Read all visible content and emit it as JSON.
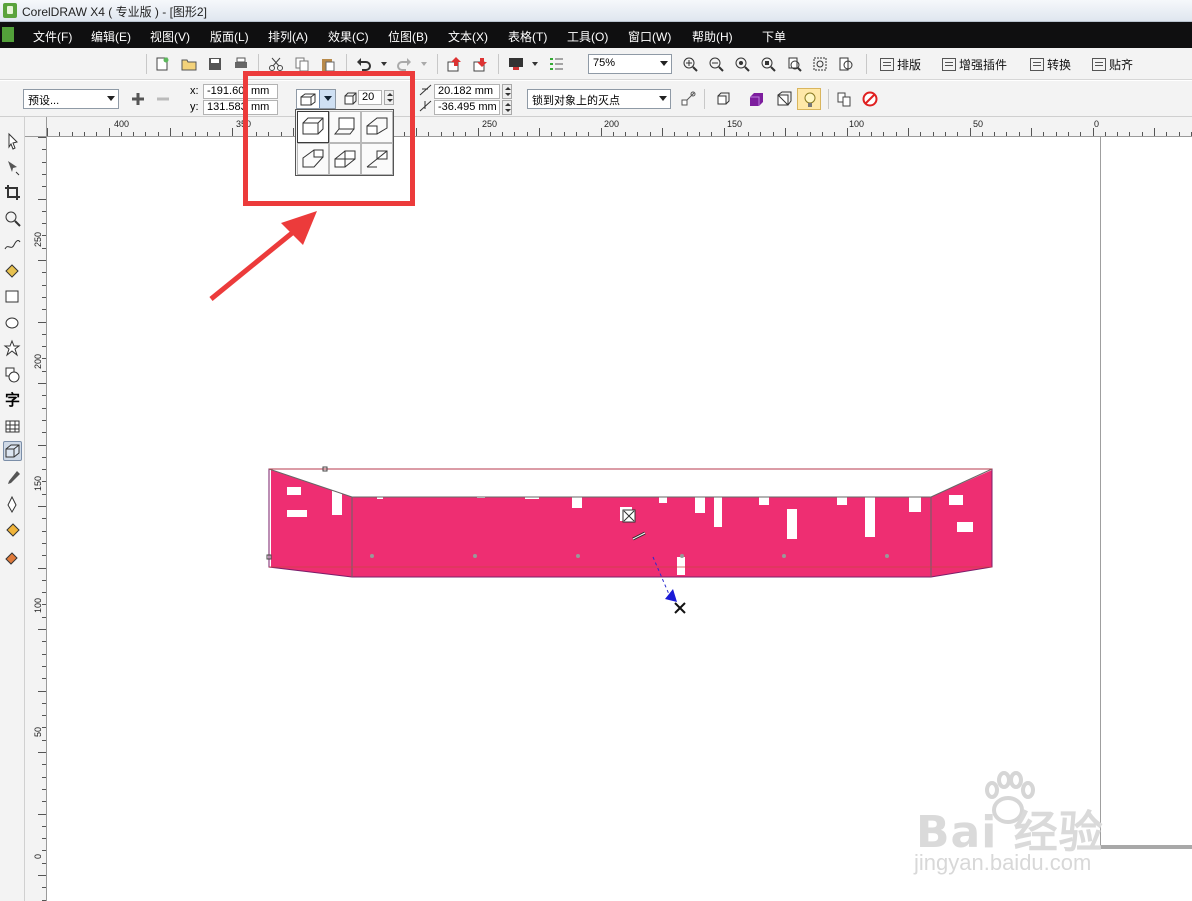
{
  "titlebar": {
    "title": "CorelDRAW X4 ( 专业版 ) - [图形2]"
  },
  "menu": [
    "文件(F)",
    "编辑(E)",
    "视图(V)",
    "版面(L)",
    "排列(A)",
    "效果(C)",
    "位图(B)",
    "文本(X)",
    "表格(T)",
    "工具(O)",
    "窗口(W)",
    "帮助(H)",
    "下单"
  ],
  "stdbar": {
    "zoom": "75%",
    "buttons": [
      "排版",
      "增强插件",
      "转换",
      "贴齐"
    ]
  },
  "propbar": {
    "preset": "预设...",
    "x_label": "x:",
    "x_value": "-191.60",
    "x_unit": "mm",
    "y_label": "y:",
    "y_value": "131.583",
    "y_unit": "mm",
    "depth": "20",
    "vp_x": "20.182 mm",
    "vp_y": "-36.495 mm",
    "vp_lock": "锁到对象上的灭点"
  },
  "ruler": {
    "h_labels": [
      "400",
      "350",
      "250",
      "200",
      "150",
      "100",
      "50",
      "0"
    ],
    "v_labels": [
      "250",
      "200",
      "150",
      "100",
      "50",
      "0"
    ]
  },
  "toolbox": {
    "text_tool": "字"
  },
  "canvas": {
    "fill_color": "#ee2e72"
  },
  "watermark": {
    "brand": "Bai 经验",
    "url": "jingyan.baidu.com"
  }
}
